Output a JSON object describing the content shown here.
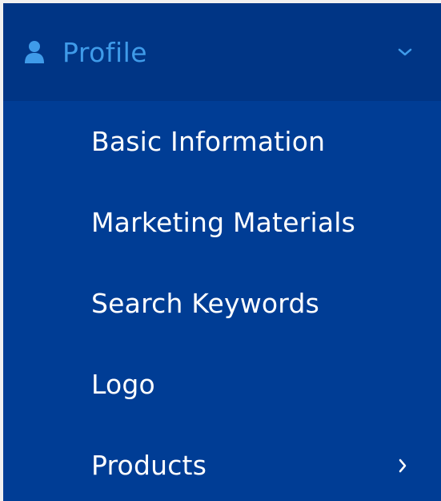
{
  "colors": {
    "background": "#003d95",
    "header_background": "#003585",
    "header_accent": "#3f9be9",
    "item_text": "#ffffff"
  },
  "header": {
    "icon": "user-icon",
    "label": "Profile",
    "toggle_icon": "chevron-down-icon",
    "expanded": true
  },
  "submenu": {
    "items": [
      {
        "label": "Basic Information"
      },
      {
        "label": "Marketing Materials"
      },
      {
        "label": "Search Keywords"
      },
      {
        "label": "Logo"
      },
      {
        "label": "Products",
        "trailing_icon": "chevron-right-icon"
      }
    ]
  }
}
